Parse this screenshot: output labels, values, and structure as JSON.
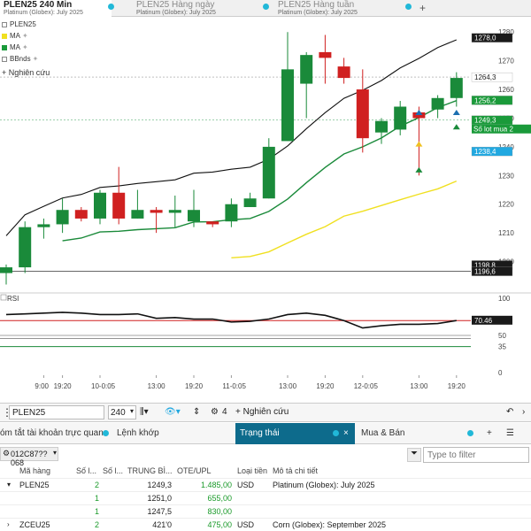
{
  "tabs": [
    {
      "title": "PLEN25 240 Min",
      "subtitle": "Platinum (Globex): July 2025",
      "active": true
    },
    {
      "title": "PLEN25 Hàng ngày",
      "subtitle": "Platinum (Globex): July 2025",
      "active": false
    },
    {
      "title": "PLEN25 Hàng tuần",
      "subtitle": "Platinum (Globex): July 2025",
      "active": false
    }
  ],
  "tab_add": "+",
  "legend": [
    {
      "label": "PLEN25",
      "color": "#ffffff"
    },
    {
      "label": "MA",
      "color": "#f0e020"
    },
    {
      "label": "MA",
      "color": "#1a9a3a"
    },
    {
      "label": "BBnds",
      "color": "#ffffff"
    }
  ],
  "research_label": "+ Nghiên cứu",
  "chart_data": {
    "type": "candlestick",
    "price_axis": {
      "min": 1190,
      "max": 1285,
      "ticks": [
        1280,
        1270,
        1260,
        1250,
        1240,
        1230,
        1220,
        1210,
        1200
      ]
    },
    "time_labels": [
      "9:00",
      "19:20",
      "10-0:05",
      "13:00",
      "19:20",
      "11-0:05",
      "13:00",
      "19:20",
      "12-0:05",
      "13:00",
      "19:20"
    ],
    "candles": [
      {
        "o": 1196,
        "h": 1199,
        "l": 1192,
        "c": 1198
      },
      {
        "o": 1198,
        "h": 1214,
        "l": 1196,
        "c": 1212
      },
      {
        "o": 1212,
        "h": 1215,
        "l": 1208,
        "c": 1213
      },
      {
        "o": 1213,
        "h": 1222,
        "l": 1210,
        "c": 1218
      },
      {
        "o": 1218,
        "h": 1219,
        "l": 1214,
        "c": 1215
      },
      {
        "o": 1215,
        "h": 1225,
        "l": 1213,
        "c": 1224
      },
      {
        "o": 1224,
        "h": 1233,
        "l": 1213,
        "c": 1215
      },
      {
        "o": 1215,
        "h": 1225,
        "l": 1215,
        "c": 1218
      },
      {
        "o": 1218,
        "h": 1219,
        "l": 1210,
        "c": 1217
      },
      {
        "o": 1217,
        "h": 1223,
        "l": 1212,
        "c": 1218
      },
      {
        "o": 1214,
        "h": 1225,
        "l": 1212,
        "c": 1218
      },
      {
        "o": 1214,
        "h": 1214,
        "l": 1212,
        "c": 1213
      },
      {
        "o": 1214,
        "h": 1222,
        "l": 1212,
        "c": 1220
      },
      {
        "o": 1219,
        "h": 1224,
        "l": 1219,
        "c": 1222
      },
      {
        "o": 1222,
        "h": 1243,
        "l": 1222,
        "c": 1240
      },
      {
        "o": 1242,
        "h": 1280,
        "l": 1242,
        "c": 1267
      },
      {
        "o": 1262,
        "h": 1273,
        "l": 1250,
        "c": 1272
      },
      {
        "o": 1273,
        "h": 1279,
        "l": 1262,
        "c": 1271
      },
      {
        "o": 1268,
        "h": 1271,
        "l": 1262,
        "c": 1264
      },
      {
        "o": 1260,
        "h": 1267,
        "l": 1238,
        "c": 1243
      },
      {
        "o": 1245,
        "h": 1250,
        "l": 1241,
        "c": 1249
      },
      {
        "o": 1246,
        "h": 1256,
        "l": 1244,
        "c": 1254
      },
      {
        "o": 1252,
        "h": 1254,
        "l": 1230,
        "c": 1250
      },
      {
        "o": 1253,
        "h": 1258,
        "l": 1250,
        "c": 1257
      },
      {
        "o": 1257,
        "h": 1266,
        "l": 1254,
        "c": 1264
      }
    ],
    "price_labels": [
      {
        "text": "1278,0",
        "value": 1278.0,
        "bg": "#1a1a1a",
        "fg": "#ffffff"
      },
      {
        "text": "1264,3",
        "value": 1264.3,
        "bg": "#ffffff",
        "fg": "#222222"
      },
      {
        "text": "1256,2",
        "value": 1256.2,
        "bg": "#1a9a3a",
        "fg": "#ffffff"
      },
      {
        "text": "1249,3",
        "value": 1249.3,
        "bg": "#1a9a3a",
        "fg": "#ffffff"
      },
      {
        "text": "1238,4",
        "value": 1238.4,
        "bg": "#21a8e0",
        "fg": "#ffffff"
      },
      {
        "text": "1198,8",
        "value": 1198.8,
        "bg": "#1a1a1a",
        "fg": "#ffffff"
      },
      {
        "text": "1196,6",
        "value": 1196.6,
        "bg": "#1a1a1a",
        "fg": "#ffffff"
      }
    ],
    "position_label": "Số lot mua 2",
    "rsi": {
      "label": "RSI",
      "axis_ticks": [
        100,
        70,
        50,
        35,
        0
      ],
      "upper": 70,
      "lower": 35,
      "mid": 50,
      "current_label": "70.46",
      "values": [
        78,
        79,
        80,
        81,
        80,
        78,
        78,
        79,
        73,
        74,
        72,
        72,
        68,
        69,
        72,
        78,
        80,
        77,
        70,
        60,
        63,
        65,
        65,
        66,
        70
      ]
    }
  },
  "toolbar": {
    "symbol": "PLEN25",
    "interval": "240",
    "indicator_count": "4",
    "research": "+ Nghiên cứu"
  },
  "panel_tabs": [
    {
      "label": "óm tắt tài khoản trực quan"
    },
    {
      "label": "Lệnh khớp"
    },
    {
      "label": "Trạng thái",
      "active": true
    },
    {
      "label": "Mua & Bán"
    }
  ],
  "account": "012C87??068",
  "filter_placeholder": "Type to filter",
  "table": {
    "headers": [
      "Mã hàng",
      "Số l...",
      "Số l...",
      "TRUNG BÌ...",
      "OTE/UPL",
      "Loại tiền",
      "Mô tả chi tiết"
    ],
    "rows": [
      {
        "symbol": "PLEN25",
        "qty1": "2",
        "qty2": "",
        "avg": "1249,3",
        "ote": "1.485,00",
        "currency": "USD",
        "desc": "Platinum (Globex): July 2025",
        "expanded": true
      },
      {
        "symbol": "",
        "qty1": "1",
        "qty2": "",
        "avg": "1251,0",
        "ote": "655,00",
        "currency": "",
        "desc": ""
      },
      {
        "symbol": "",
        "qty1": "1",
        "qty2": "",
        "avg": "1247,5",
        "ote": "830,00",
        "currency": "",
        "desc": ""
      },
      {
        "symbol": "ZCEU25",
        "qty1": "2",
        "qty2": "",
        "avg": "421'0",
        "ote": "475,00",
        "currency": "USD",
        "desc": "Corn (Globex): September 2025",
        "expanded": false
      }
    ]
  }
}
